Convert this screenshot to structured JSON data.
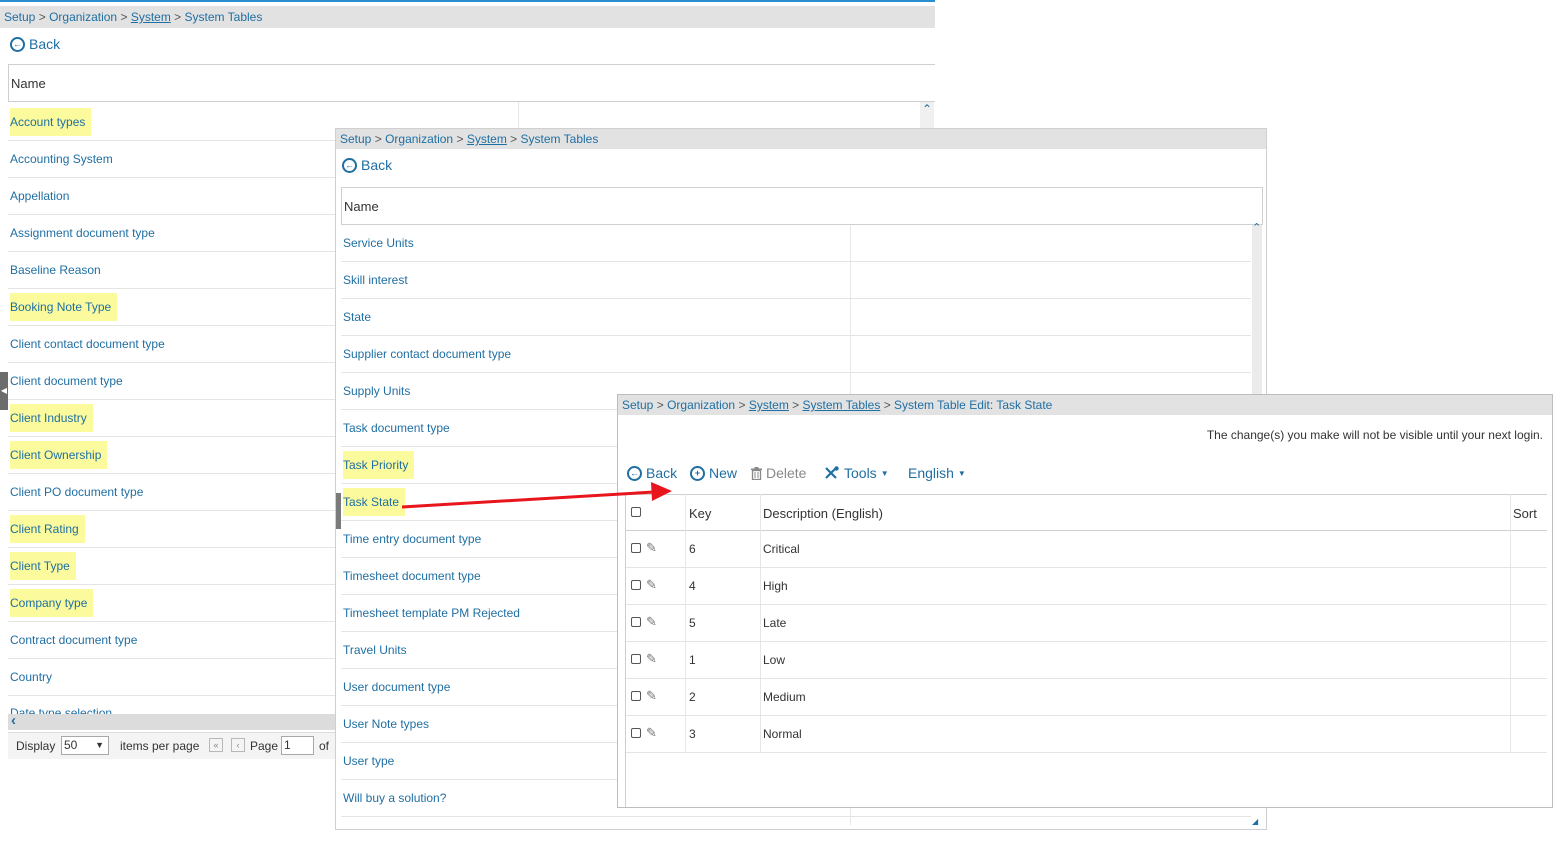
{
  "panel1": {
    "breadcrumb": {
      "setup": "Setup",
      "organization": "Organization",
      "system": "System",
      "current": "System Tables"
    },
    "back_label": "Back",
    "column_name": "Name",
    "rows": [
      {
        "label": "Account types",
        "highlight": true
      },
      {
        "label": "Accounting System",
        "highlight": false
      },
      {
        "label": "Appellation",
        "highlight": false
      },
      {
        "label": "Assignment document type",
        "highlight": false
      },
      {
        "label": "Baseline Reason",
        "highlight": false
      },
      {
        "label": "Booking Note Type",
        "highlight": true
      },
      {
        "label": "Client contact document type",
        "highlight": false
      },
      {
        "label": "Client document type",
        "highlight": false
      },
      {
        "label": "Client Industry",
        "highlight": true
      },
      {
        "label": "Client Ownership",
        "highlight": true
      },
      {
        "label": "Client PO document type",
        "highlight": false
      },
      {
        "label": "Client Rating",
        "highlight": true
      },
      {
        "label": "Client Type",
        "highlight": true
      },
      {
        "label": "Company type",
        "highlight": true
      },
      {
        "label": "Contract document type",
        "highlight": false
      },
      {
        "label": "Country",
        "highlight": false
      }
    ],
    "partial_row": "Date type selection",
    "pager": {
      "display": "Display",
      "per_page_value": "50",
      "items_per_page": "items per page",
      "page": "Page",
      "page_value": "1",
      "of": "of"
    }
  },
  "panel2": {
    "breadcrumb": {
      "setup": "Setup",
      "organization": "Organization",
      "system": "System",
      "current": "System Tables"
    },
    "back_label": "Back",
    "column_name": "Name",
    "rows": [
      {
        "label": "Service Units",
        "highlight": false
      },
      {
        "label": "Skill interest",
        "highlight": false
      },
      {
        "label": "State",
        "highlight": false
      },
      {
        "label": "Supplier contact document type",
        "highlight": false
      },
      {
        "label": "Supply Units",
        "highlight": false
      },
      {
        "label": "Task document type",
        "highlight": false
      },
      {
        "label": "Task Priority",
        "highlight": true
      },
      {
        "label": "Task State",
        "highlight": true
      },
      {
        "label": "Time entry document type",
        "highlight": false
      },
      {
        "label": "Timesheet document type",
        "highlight": false
      },
      {
        "label": "Timesheet template PM Rejected",
        "highlight": false
      },
      {
        "label": "Travel Units",
        "highlight": false
      },
      {
        "label": "User document type",
        "highlight": false
      },
      {
        "label": "User Note types",
        "highlight": false
      },
      {
        "label": "User type",
        "highlight": false
      },
      {
        "label": "Will buy a solution?",
        "highlight": false
      }
    ]
  },
  "panel3": {
    "breadcrumb": {
      "setup": "Setup",
      "organization": "Organization",
      "system": "System",
      "system_tables": "System Tables",
      "current": "System Table Edit: Task State"
    },
    "notice": "The change(s) you make will not be visible until your next login.",
    "toolbar": {
      "back": "Back",
      "new": "New",
      "delete": "Delete",
      "tools": "Tools",
      "language": "English"
    },
    "columns": {
      "key": "Key",
      "description": "Description (English)",
      "sort": "Sort"
    },
    "rows": [
      {
        "key": "6",
        "description": "Critical"
      },
      {
        "key": "4",
        "description": "High"
      },
      {
        "key": "5",
        "description": "Late"
      },
      {
        "key": "1",
        "description": "Low"
      },
      {
        "key": "2",
        "description": "Medium"
      },
      {
        "key": "3",
        "description": "Normal"
      }
    ]
  },
  "icons": {
    "back": "circle-arrow-left-icon",
    "new": "circle-plus-icon",
    "delete": "trash-icon",
    "tools": "wrench-icon",
    "edit": "pencil-icon"
  },
  "colors": {
    "link": "#1f6fa3",
    "highlight": "#fbfa9c",
    "breadcrumb_bg": "#e2e2e2",
    "annotation_arrow": "#e8161c"
  }
}
